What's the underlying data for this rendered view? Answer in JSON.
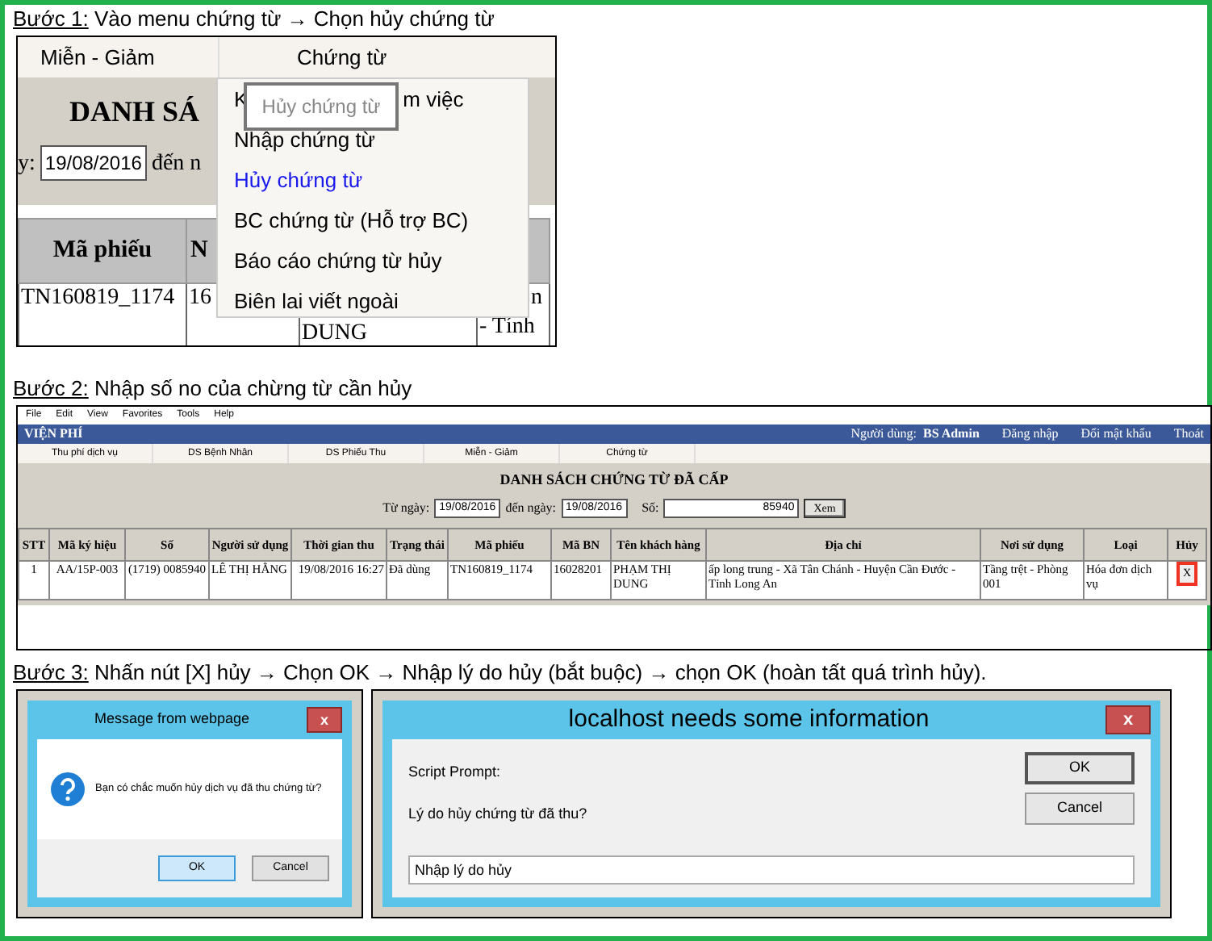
{
  "step_1": {
    "heading": {
      "label": "Bước 1:",
      "text": "Vào menu chứng từ → Chọn hủy chứng từ"
    },
    "screenshot": {
      "menu_bar": [
        "Miễn - Giảm",
        "Chứng từ"
      ],
      "page_title": "DANH SÁ",
      "date_prefix": "y:",
      "date_value": "19/08/2016",
      "date_suffix": "đến n",
      "columns": [
        "Mã phiếu",
        "N"
      ],
      "row": [
        [
          "TN160819_1174"
        ],
        [
          "16"
        ],
        [
          "DUNG"
        ],
        [
          "n",
          "- Tính"
        ]
      ],
      "dropdown": [
        {
          "parts": [
            "K",
            "m việc"
          ],
          "selected": false
        },
        {
          "parts": [
            "Nhập chứng từ"
          ],
          "selected": false
        },
        {
          "parts": [
            "Hủy chứng từ"
          ],
          "selected": true
        },
        {
          "parts": [
            "BC chứng từ (Hỗ trợ BC)"
          ],
          "selected": false
        },
        {
          "parts": [
            "Báo cáo chứng từ hủy"
          ],
          "selected": false
        },
        {
          "parts": [
            "Biên lai viết ngoài"
          ],
          "selected": false
        }
      ],
      "tooltip": "Hủy chứng từ"
    }
  },
  "step_2": {
    "heading": {
      "label": "Bước 2:",
      "text": "Nhập số no của chừng từ cần hủy"
    },
    "screenshot": {
      "browser_menu": [
        "File",
        "Edit",
        "View",
        "Favorites",
        "Tools",
        "Help"
      ],
      "app_title": "VIỆN PHÍ",
      "user_label": "Người dùng:",
      "user_name": "BS Admin",
      "header_links": [
        "Đăng nhập",
        "Đổi mật khẩu",
        "Thoát"
      ],
      "tabs": [
        "Thu phí dịch vụ",
        "DS Bệnh Nhân",
        "DS Phiếu Thu",
        "Miễn - Giảm",
        "Chứng từ"
      ],
      "title": "DANH SÁCH CHỨNG TỪ ĐÃ CẤP",
      "from_label": "Từ ngày:",
      "from_value": "19/08/2016",
      "to_label": "đến ngày:",
      "to_value": "19/08/2016",
      "number_label": "Số:",
      "number_value": "85940",
      "view_button": "Xem",
      "columns": [
        "STT",
        "Mã ký hiệu",
        "Số",
        "Người sử dụng",
        "Thời gian thu",
        "Trạng thái",
        "Mã phiếu",
        "Mã BN",
        "Tên khách hàng",
        "Địa chỉ",
        "Nơi sử dụng",
        "Loại",
        "Hủy"
      ],
      "row": [
        "1",
        "AA/15P-003",
        "(1719) 0085940",
        "LÊ THỊ HẰNG",
        "19/08/2016 16:27",
        "Đã dùng",
        "TN160819_1174",
        "16028201",
        "PHẠM THỊ DUNG",
        "ấp long trung - Xã Tân Chánh - Huyện Cần Đước - Tỉnh Long An",
        "Tầng trệt - Phòng 001",
        "Hóa đơn dịch vụ",
        "X"
      ]
    }
  },
  "step_3": {
    "heading": {
      "label": "Bước 3:",
      "text": "Nhấn nút [X] hủy → Chọn OK → Nhập lý do hủy (bắt buộc) → chọn OK (hoàn tất quá trình hủy)."
    },
    "confirm_dialog": {
      "title": "Message from webpage",
      "close": "x",
      "message": "Bạn có chắc muốn hủy dịch vụ đã thu chứng từ?",
      "buttons": [
        "OK",
        "Cancel"
      ]
    },
    "prompt_dialog": {
      "title": "localhost needs some information",
      "close": "x",
      "label": "Script Prompt:",
      "question": "Lý do hủy chứng từ đã thu?",
      "buttons": [
        "OK",
        "Cancel"
      ],
      "value": "Nhập lý do hủy"
    }
  }
}
